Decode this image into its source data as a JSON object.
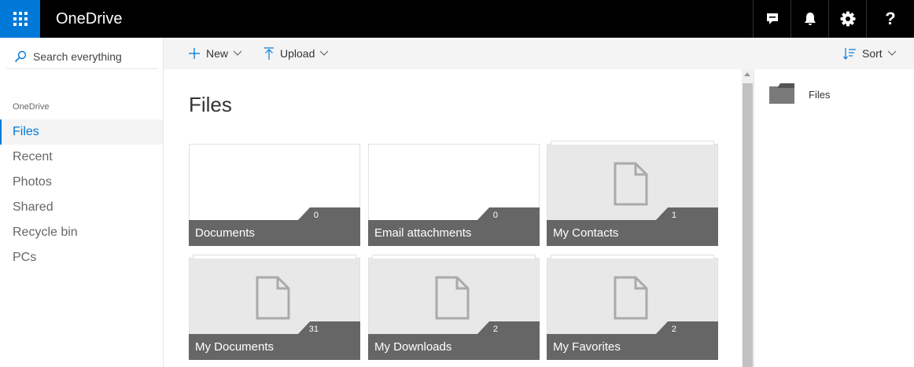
{
  "app": {
    "title": "OneDrive"
  },
  "search": {
    "placeholder": "Search everything"
  },
  "nav": {
    "heading": "OneDrive",
    "items": [
      {
        "label": "Files",
        "active": true
      },
      {
        "label": "Recent",
        "active": false
      },
      {
        "label": "Photos",
        "active": false
      },
      {
        "label": "Shared",
        "active": false
      },
      {
        "label": "Recycle bin",
        "active": false
      },
      {
        "label": "PCs",
        "active": false
      }
    ]
  },
  "toolbar": {
    "new_label": "New",
    "upload_label": "Upload",
    "sort_label": "Sort"
  },
  "main": {
    "title": "Files",
    "folders": [
      {
        "name": "Documents",
        "count": "0"
      },
      {
        "name": "Email attachments",
        "count": "0"
      },
      {
        "name": "My Contacts",
        "count": "1"
      },
      {
        "name": "My Documents",
        "count": "31"
      },
      {
        "name": "My Downloads",
        "count": "2"
      },
      {
        "name": "My Favorites",
        "count": "2"
      }
    ]
  },
  "details_pane": {
    "label": "Files"
  },
  "colors": {
    "accent": "#0078d7",
    "topbar": "#000000",
    "tile_footer": "#666666"
  },
  "icons": {
    "app_launcher": "waffle-icon",
    "feedback": "feedback-icon",
    "notifications": "bell-icon",
    "settings": "gear-icon",
    "help": "help-icon",
    "search": "search-icon",
    "new": "plus-icon",
    "upload": "upload-icon",
    "sort": "sort-icon",
    "folder": "folder-icon",
    "document": "document-icon"
  }
}
